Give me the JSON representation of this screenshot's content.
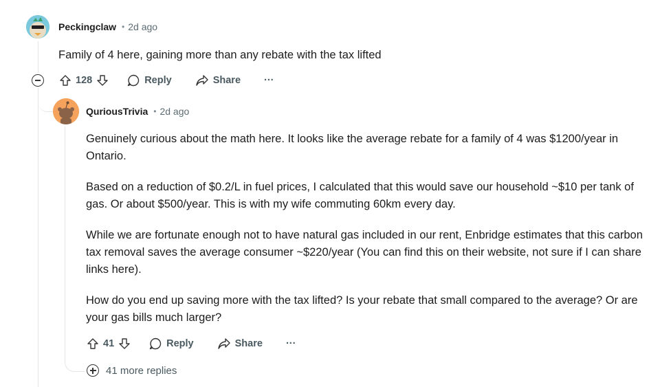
{
  "comment": {
    "author": "Peckingclaw",
    "time": "2d ago",
    "text": "Family of 4 here, gaining more than any rebate with the tax lifted",
    "votes": "128",
    "reply_label": "Reply",
    "share_label": "Share",
    "more_label": "···"
  },
  "reply": {
    "author": "QuriousTrivia",
    "time": "2d ago",
    "paragraphs": [
      "Genuinely curious about the math here. It looks like the average rebate for a family of 4 was $1200/year in Ontario.",
      "Based on a reduction of $0.2/L in fuel prices, I calculated that this would save our household ~$10 per tank of gas. Or about $500/year. This is with my wife commuting 60km every day.",
      "While we are fortunate enough not to have natural gas included in our rent, Enbridge estimates that this carbon tax removal saves the average consumer ~$220/year (You can find this on their website, not sure if I can share links here).",
      "How do you end up saving more with the tax lifted? Is your rebate that small compared to the average? Or are your gas bills much larger?"
    ],
    "votes": "41",
    "reply_label": "Reply",
    "share_label": "Share",
    "more_label": "···",
    "more_replies": "41 more replies"
  },
  "colors": {
    "avatar_orange": "#f5a25d",
    "thread_line": "#e2e6e9",
    "meta_text": "#5c6c74"
  }
}
